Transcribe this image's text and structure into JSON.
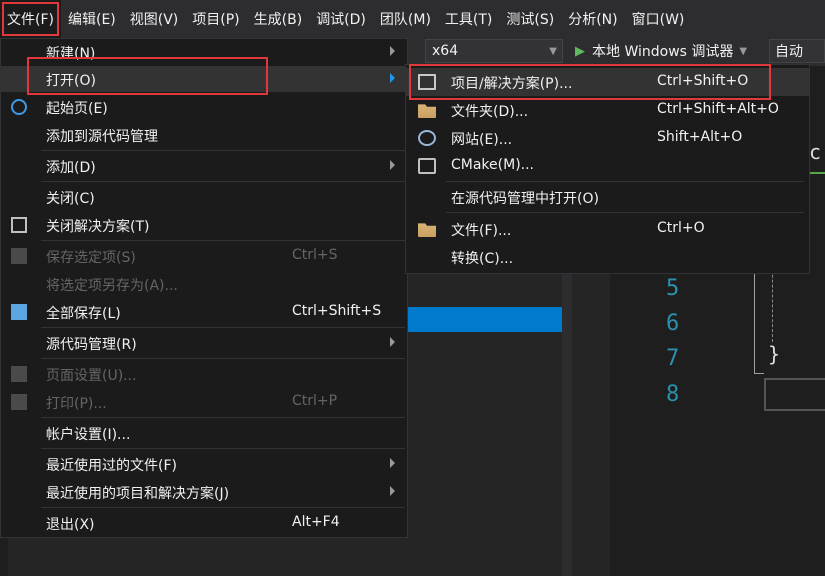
{
  "menubar": {
    "items": [
      "文件(F)",
      "编辑(E)",
      "视图(V)",
      "项目(P)",
      "生成(B)",
      "调试(D)",
      "团队(M)",
      "工具(T)",
      "测试(S)",
      "分析(N)",
      "窗口(W)"
    ]
  },
  "toolbar": {
    "platform": "x64",
    "run_label": "本地 Windows 调试器",
    "auto_label": "自动"
  },
  "editor": {
    "line_numbers": [
      "5",
      "6",
      "7",
      "8"
    ],
    "brace": "}",
    "partial_char": "c"
  },
  "file_menu": {
    "new": "新建(N)",
    "open": "打开(O)",
    "start_page": "起始页(E)",
    "add_to_source_control": "添加到源代码管理",
    "add": "添加(D)",
    "close": "关闭(C)",
    "close_solution": "关闭解决方案(T)",
    "save_selected": "保存选定项(S)",
    "save_selected_shortcut": "Ctrl+S",
    "save_selected_as": "将选定项另存为(A)...",
    "save_all": "全部保存(L)",
    "save_all_shortcut": "Ctrl+Shift+S",
    "source_control": "源代码管理(R)",
    "page_setup": "页面设置(U)...",
    "print": "打印(P)...",
    "print_shortcut": "Ctrl+P",
    "account_settings": "帐户设置(I)...",
    "recent_files": "最近使用过的文件(F)",
    "recent_projects": "最近使用的项目和解决方案(J)",
    "exit": "退出(X)",
    "exit_shortcut": "Alt+F4"
  },
  "open_submenu": {
    "project_solution": "项目/解决方案(P)...",
    "project_solution_shortcut": "Ctrl+Shift+O",
    "folder": "文件夹(D)...",
    "folder_shortcut": "Ctrl+Shift+Alt+O",
    "website": "网站(E)...",
    "website_shortcut": "Shift+Alt+O",
    "cmake": "CMake(M)...",
    "open_from_source_control": "在源代码管理中打开(O)",
    "file": "文件(F)...",
    "file_shortcut": "Ctrl+O",
    "convert": "转换(C)..."
  },
  "colors": {
    "highlight_box": "#e0383b",
    "selection": "#007acc",
    "menu_bg": "#1b1b1c",
    "accent_play": "#5fb85f",
    "line_number": "#2b91af"
  }
}
